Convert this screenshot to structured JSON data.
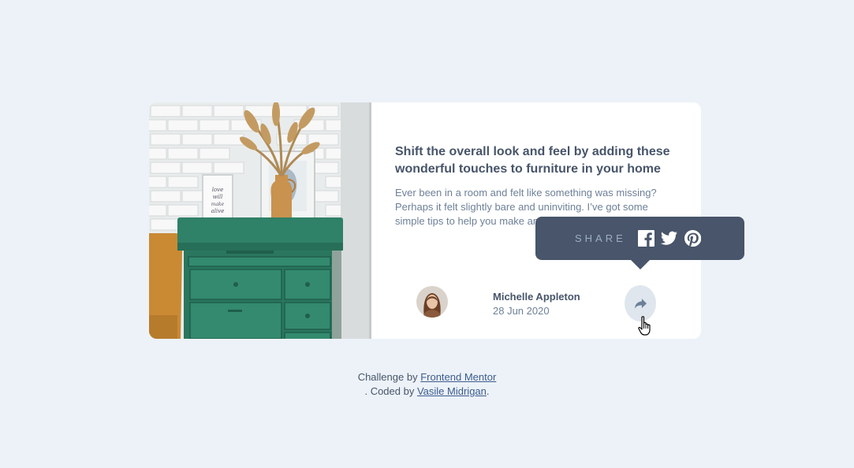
{
  "card": {
    "title": "Shift the overall look and feel by adding these wonderful touches to furniture in your home",
    "description": "Ever been in a room and felt like something was missing? Perhaps it felt slightly bare and uninviting. I’ve got some simple tips to help you make any room feel complete.",
    "author_name": "Michelle Appleton",
    "author_date": "28 Jun 2020",
    "photo_frame_text": "love will make alive"
  },
  "share_tooltip": {
    "label": "SHARE",
    "icons": [
      "facebook-icon",
      "twitter-icon",
      "pinterest-icon"
    ]
  },
  "attribution": {
    "prefix": "Challenge by",
    "link1": "Frontend Mentor",
    "middle": ". Coded by",
    "link2": "Vasile Midrigan",
    "suffix": "."
  },
  "colors": {
    "background": "#ecf2f8",
    "tooltip": "#48556a",
    "heading": "#48556a",
    "body_text": "#6e8098",
    "share_button": "#dfe6ee",
    "dresser_green": "#2e7a62"
  }
}
